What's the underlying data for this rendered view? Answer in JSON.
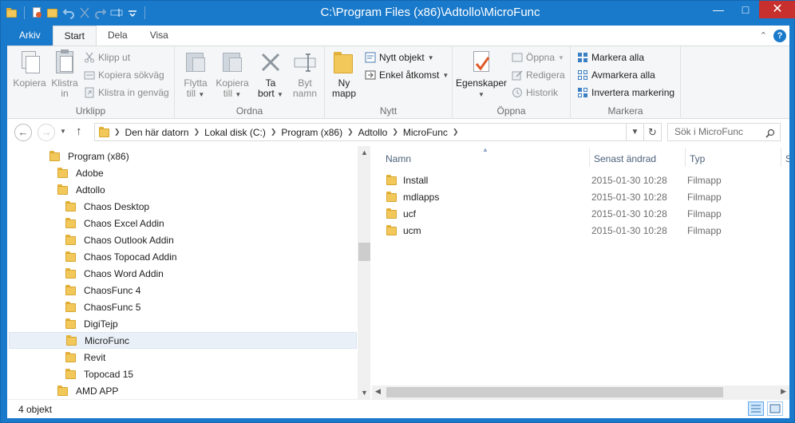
{
  "window": {
    "title": "C:\\Program Files (x86)\\Adtollo\\MicroFunc"
  },
  "ribbon_tabs": [
    {
      "label": "Arkiv"
    },
    {
      "label": "Start"
    },
    {
      "label": "Dela"
    },
    {
      "label": "Visa"
    }
  ],
  "ribbon": {
    "urklipp": {
      "label": "Urklipp",
      "kopiera": "Kopiera",
      "klistra_in_1": "Klistra",
      "klistra_in_2": "in",
      "klipp_ut": "Klipp ut",
      "kopiera_sokvag": "Kopiera sökväg",
      "klistra_in_genvag": "Klistra in genväg"
    },
    "ordna": {
      "label": "Ordna",
      "flytta_1": "Flytta",
      "flytta_2": "till",
      "kopiera_1": "Kopiera",
      "kopiera_2": "till",
      "ta_bort_1": "Ta",
      "ta_bort_2": "bort",
      "byt_namn_1": "Byt",
      "byt_namn_2": "namn"
    },
    "nytt": {
      "label": "Nytt",
      "ny_mapp_1": "Ny",
      "ny_mapp_2": "mapp",
      "nytt_objekt": "Nytt objekt",
      "enkel_atkomst": "Enkel åtkomst"
    },
    "oppna": {
      "label": "Öppna",
      "egenskaper": "Egenskaper",
      "oppna": "Öppna",
      "redigera": "Redigera",
      "historik": "Historik"
    },
    "markera": {
      "label": "Markera",
      "markera_alla": "Markera alla",
      "avmarkera_alla": "Avmarkera alla",
      "invertera": "Invertera markering"
    }
  },
  "address": {
    "crumbs": [
      "Den här datorn",
      "Lokal disk (C:)",
      "Program (x86)",
      "Adtollo",
      "MicroFunc"
    ],
    "search_placeholder": "Sök i MicroFunc"
  },
  "tree": [
    {
      "label": "Program (x86)",
      "level": 0
    },
    {
      "label": "Adobe",
      "level": 1
    },
    {
      "label": "Adtollo",
      "level": 1
    },
    {
      "label": "Chaos Desktop",
      "level": 2
    },
    {
      "label": "Chaos Excel Addin",
      "level": 2
    },
    {
      "label": "Chaos Outlook Addin",
      "level": 2
    },
    {
      "label": "Chaos Topocad Addin",
      "level": 2
    },
    {
      "label": "Chaos Word Addin",
      "level": 2
    },
    {
      "label": "ChaosFunc 4",
      "level": 2
    },
    {
      "label": "ChaosFunc 5",
      "level": 2
    },
    {
      "label": "DigiTejp",
      "level": 2
    },
    {
      "label": "MicroFunc",
      "level": 2,
      "selected": true
    },
    {
      "label": "Revit",
      "level": 2
    },
    {
      "label": "Topocad 15",
      "level": 2
    },
    {
      "label": "AMD APP",
      "level": 1
    }
  ],
  "columns": {
    "name": "Namn",
    "date": "Senast ändrad",
    "type": "Typ",
    "size": "S"
  },
  "files": [
    {
      "name": "Install",
      "date": "2015-01-30 10:28",
      "type": "Filmapp"
    },
    {
      "name": "mdlapps",
      "date": "2015-01-30 10:28",
      "type": "Filmapp"
    },
    {
      "name": "ucf",
      "date": "2015-01-30 10:28",
      "type": "Filmapp"
    },
    {
      "name": "ucm",
      "date": "2015-01-30 10:28",
      "type": "Filmapp"
    }
  ],
  "status": {
    "count": "4 objekt"
  },
  "icons": {
    "folder": "folder-icon",
    "back": "back-arrow-icon",
    "forward": "forward-arrow-icon",
    "up": "up-arrow-icon",
    "refresh": "refresh-icon",
    "search": "search-icon",
    "help": "help-icon"
  },
  "colors": {
    "accent": "#1979ca",
    "folder": "#f3c85a",
    "close": "#c7302c"
  }
}
